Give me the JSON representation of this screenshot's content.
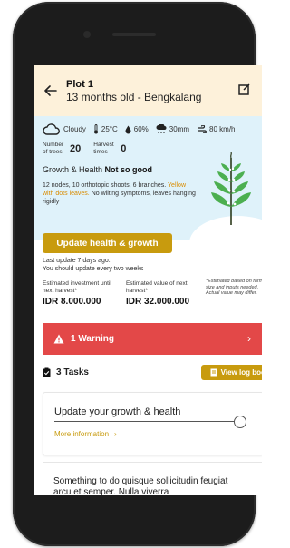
{
  "header": {
    "title": "Plot 1",
    "subtitle": "13 months old - Bengkalang"
  },
  "weather": {
    "condition": "Cloudy",
    "temperature": "25°C",
    "humidity": "60%",
    "rain": "30mm",
    "wind": "80 km/h"
  },
  "stats": {
    "trees_label": "Number of trees",
    "trees_value": "20",
    "harvest_label": "Harvest times",
    "harvest_value": "0"
  },
  "health": {
    "label": "Growth & Health",
    "status": "Not so good",
    "desc_1": "12 nodes, 10 orthotopic shoots, 6 branches.",
    "desc_yellow": "Yellow with dots leaves.",
    "desc_2": " No wilting symptoms, leaves hanging rigidly"
  },
  "update_button": "Update health & growth",
  "meta": {
    "last_update": "Last update 7 days ago.",
    "frequency": "You should update every two weeks"
  },
  "estimates": {
    "investment_label": "Estimated investment until next harvest*",
    "investment_value": "IDR 8.000.000",
    "value_label": "Estimated value of next harvest*",
    "value_value": "IDR 32.000.000",
    "note": "*Estimated based on farm size and inputs needed. Actual value may differ."
  },
  "warning": {
    "label": "1 Warning",
    "color": "#e34848"
  },
  "tasks": {
    "label": "3 Tasks",
    "logbook_label": "View log book"
  },
  "task_card": {
    "title": "Update your growth & health",
    "more": "More information",
    "progress": 0.95
  },
  "task_card_2": {
    "text": "Something to do quisque sollicitudin feugiat arcu et semper. Nulla viverra"
  },
  "colors": {
    "header_bg": "#fdf1da",
    "info_bg": "#dff2fa",
    "accent": "#c89b0e"
  }
}
